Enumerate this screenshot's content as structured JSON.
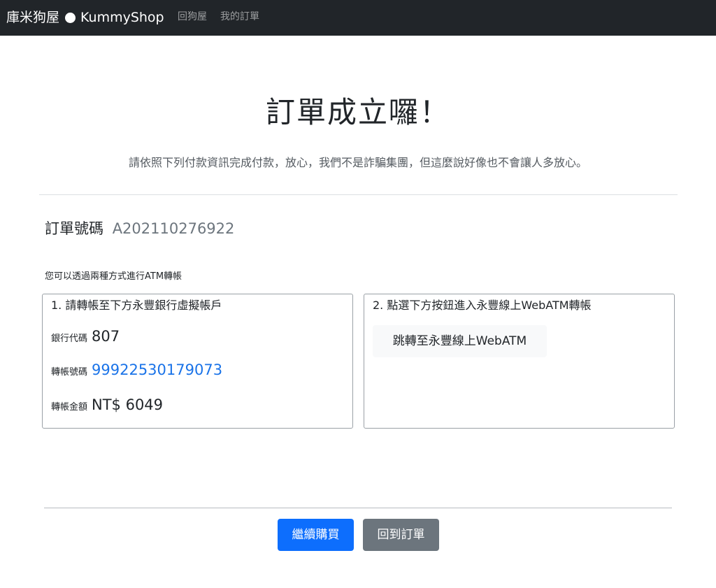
{
  "navbar": {
    "brand_prefix": "庫米狗屋",
    "brand_suffix": "KummyShop",
    "links": [
      "回狗屋",
      "我的訂單"
    ]
  },
  "main": {
    "title": "訂單成立囉！",
    "lead": "請依照下列付款資訊完成付款，放心，我們不是詐騙集團，但這麼說好像也不會讓人多放心。",
    "order_label": "訂單號碼",
    "order_number": "A202110276922",
    "intro": "您可以透過兩種方式進行ATM轉帳"
  },
  "card_bank": {
    "title": "1. 請轉帳至下方永豐銀行虛擬帳戶",
    "bank_code_label": "銀行代碼",
    "bank_code": "807",
    "account_label": "轉帳號碼",
    "account": "99922530179073",
    "amount_label": "轉帳金額",
    "amount": "NT$ 6049"
  },
  "card_webatm": {
    "title": "2. 點選下方按鈕進入永豐線上WebATM轉帳",
    "button_label": "跳轉至永豐線上WebATM"
  },
  "actions": {
    "continue_label": "繼續購買",
    "back_label": "回到訂單"
  },
  "colors": {
    "navbar": "#212529",
    "primary": "#0d6efd",
    "secondary": "#6c757d",
    "link": "#1a73e8"
  }
}
